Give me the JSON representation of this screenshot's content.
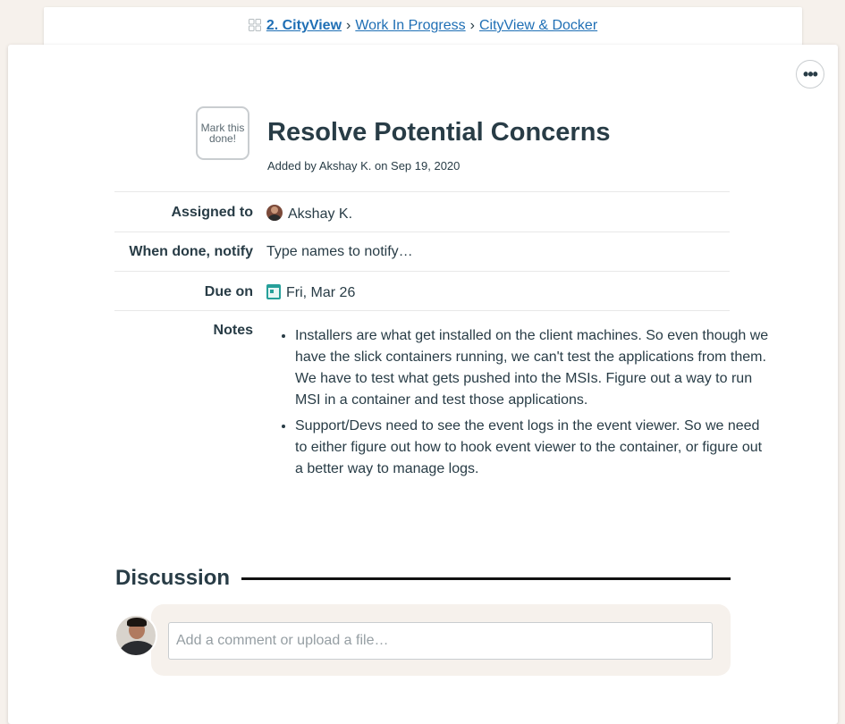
{
  "breadcrumb": {
    "project": "2. CityView",
    "separator": "›",
    "list": "Work In Progress",
    "item": "CityView & Docker"
  },
  "todo": {
    "done_button": "Mark this done!",
    "title": "Resolve Potential Concerns",
    "added_by": "Added by Akshay K. on Sep 19, 2020"
  },
  "fields": {
    "assigned_label": "Assigned to",
    "assigned_value": "Akshay K.",
    "notify_label": "When done, notify",
    "notify_placeholder": "Type names to notify…",
    "due_label": "Due on",
    "due_value": "Fri, Mar 26",
    "notes_label": "Notes"
  },
  "notes": [
    "Installers are what get installed on the client machines. So even though we have the slick containers running, we can't test the applications from them. We have to test what gets pushed into the MSIs. Figure out a way to run MSI in a container and test those applications.",
    "Support/Devs need to see the event logs in the event viewer. So we need to either figure out how to hook event viewer to the container, or figure out a better way to manage logs."
  ],
  "discussion": {
    "heading": "Discussion",
    "comment_placeholder": "Add a comment or upload a file…"
  },
  "icons": {
    "more": "more-options-icon",
    "calendar": "calendar-icon",
    "project": "grid-icon"
  },
  "colors": {
    "link": "#1f6fb5",
    "background": "#f6f1ec",
    "text": "#283c46",
    "calendar_accent": "#26a09a"
  }
}
